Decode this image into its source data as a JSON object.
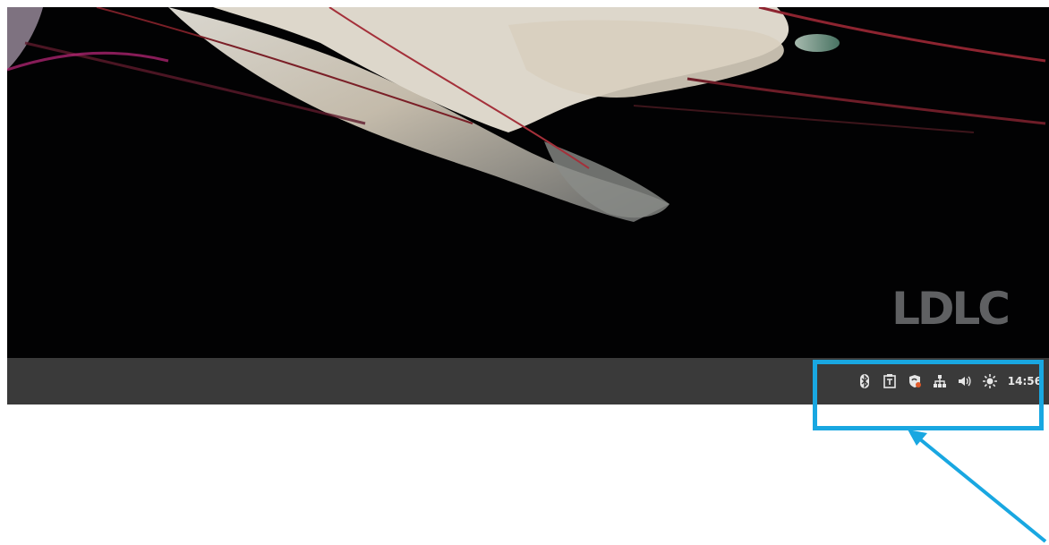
{
  "wallpaper": {
    "logo_text": "LDLC"
  },
  "taskbar": {
    "tray_icons": [
      "bluetooth-icon",
      "clipboard-icon",
      "shield-icon",
      "network-icon",
      "volume-icon",
      "brightness-icon"
    ],
    "clock": "14:56"
  },
  "annotation": {
    "highlight_color": "#19a7e1"
  }
}
